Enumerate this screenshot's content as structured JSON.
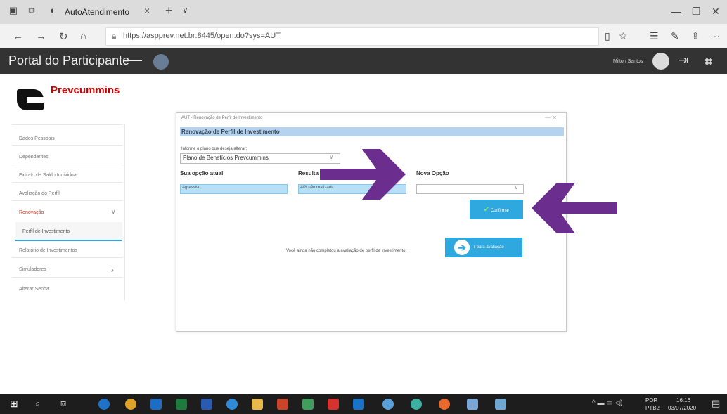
{
  "browser": {
    "tab_title": "AutoAtendimento",
    "tab_close": "×",
    "tab_new": "+",
    "tab_chevron": "∨",
    "url": "https://aspprev.net.br:8445/open.do?sys=AUT",
    "nav": {
      "back": "←",
      "forward": "→",
      "refresh": "↻",
      "home": "⌂"
    },
    "tools": {
      "reading": "▯",
      "favorite": "☆",
      "favorites": "☰",
      "pen": "✎",
      "share": "⇪",
      "more": "···"
    },
    "window": {
      "minimize": "—",
      "restore": "❐",
      "close": "✕"
    }
  },
  "portal": {
    "title": "Portal do Participante",
    "menu_toggle": "—",
    "user_name": "Milton Santos",
    "logout_icon": "⇥",
    "apps_icon": "▦"
  },
  "logo": {
    "text": "Prevcummins"
  },
  "sidebar": {
    "items": [
      {
        "label": "Dados Pessoais"
      },
      {
        "label": "Dependentes"
      },
      {
        "label": "Extrato de Saldo Individual"
      },
      {
        "label": "Avaliação do Perfil"
      },
      {
        "label": "Renovação"
      },
      {
        "label": "Perfil de Investimento"
      },
      {
        "label": "Relatório de Investimentos"
      },
      {
        "label": "Simuladores"
      },
      {
        "label": "Alterar Senha"
      }
    ],
    "chev_down": "∨",
    "chev_right": "›"
  },
  "dialog": {
    "title": "AUT - Renovação de Perfil de Investimento",
    "controls": "— ✕",
    "band": "Renovação de Perfil de Investimento",
    "plan_label": "Informe o plano que deseja alterar:",
    "plan_value": "Plano de Benefícios Prevcummins",
    "chevron": "∨",
    "col_atual": "Sua opção atual",
    "col_result": "Resulta",
    "col_nova": "Nova Opção",
    "atual_value": "Agressivo",
    "result_value": "API não realizada",
    "confirm_label": "Confirmar",
    "confirm_check": "✔",
    "message": "Você ainda não completou a avaliação de perfil de investimento.",
    "eval_label": "r para avaliação",
    "eval_arrow": "➔"
  },
  "colors": {
    "arrow": "#6b2d8e",
    "accent": "#2ea8de",
    "brand_red": "#d40000"
  },
  "taskbar": {
    "lang": "POR",
    "lang2": "PTB2",
    "time": "16:16",
    "date": "03/07/2020",
    "tray": "^ ▬ ▭ ◁)"
  }
}
